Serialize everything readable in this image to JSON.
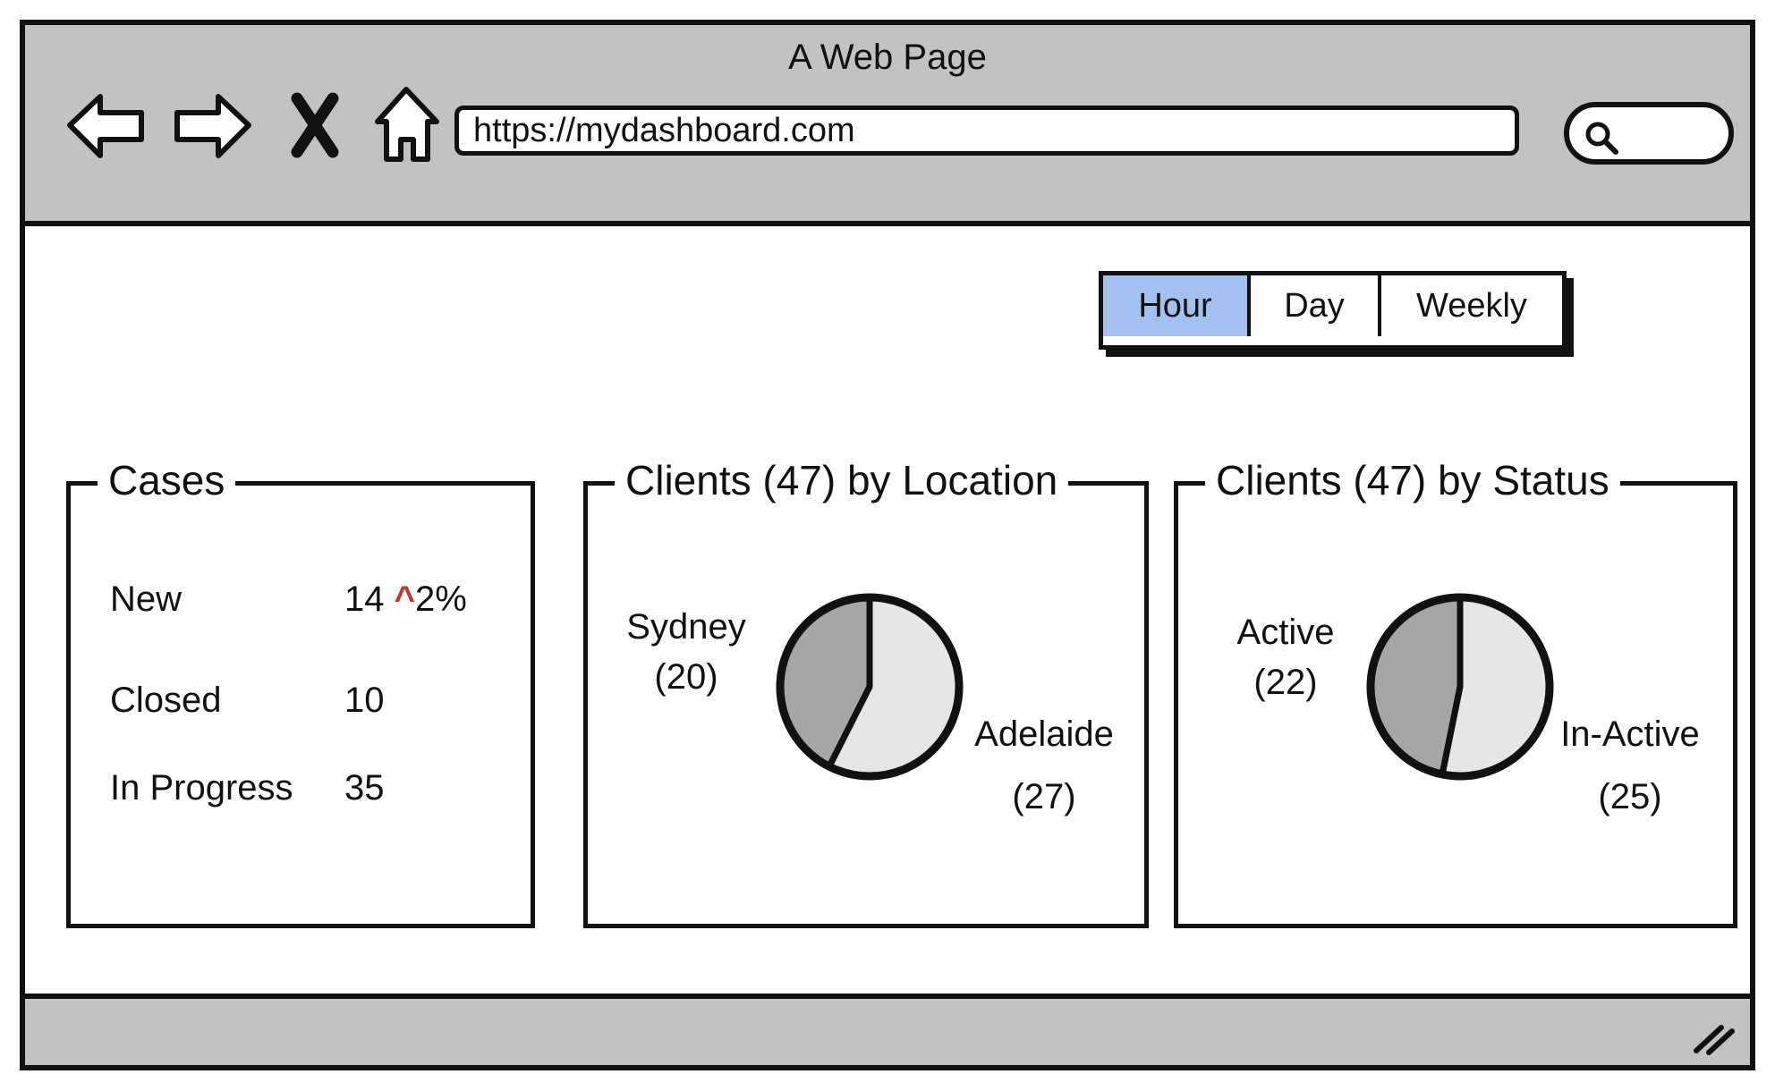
{
  "window": {
    "title": "A Web Page"
  },
  "toolbar": {
    "back_icon": "back-arrow-icon",
    "forward_icon": "forward-arrow-icon",
    "close_icon": "close-x-icon",
    "home_icon": "home-icon",
    "url": "https://mydashboard.com",
    "search_icon": "search-icon"
  },
  "time_filter": {
    "options": [
      "Hour",
      "Day",
      "Weekly"
    ],
    "selected": "Hour",
    "active_color": "#a3c1f0"
  },
  "cases": {
    "title": "Cases",
    "rows": [
      {
        "label": "New",
        "value": "14",
        "trend_symbol": "^",
        "trend": "2%"
      },
      {
        "label": "Closed",
        "value": "10"
      },
      {
        "label": "In Progress",
        "value": "35"
      }
    ],
    "trend_color": "#c0392b"
  },
  "chart_data": [
    {
      "type": "pie",
      "title": "Clients (47) by Location",
      "categories": [
        "Sydney",
        "Adelaide"
      ],
      "values": [
        20,
        27
      ],
      "labels": [
        {
          "name": "Sydney",
          "count": "(20)"
        },
        {
          "name": "Adelaide",
          "count": "(27)"
        }
      ],
      "colors": [
        "#a6a6a6",
        "#e6e6e6"
      ]
    },
    {
      "type": "pie",
      "title": "Clients (47) by Status",
      "categories": [
        "Active",
        "In-Active"
      ],
      "values": [
        22,
        25
      ],
      "labels": [
        {
          "name": "Active",
          "count": "(22)"
        },
        {
          "name": "In-Active",
          "count": "(25)"
        }
      ],
      "colors": [
        "#a6a6a6",
        "#e6e6e6"
      ]
    }
  ]
}
